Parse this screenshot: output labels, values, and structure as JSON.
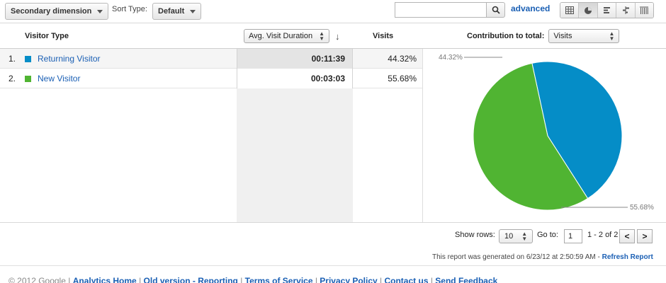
{
  "toolbar": {
    "secondary_dimension": "Secondary dimension",
    "sort_type_label": "Sort Type:",
    "sort_type_value": "Default",
    "search_placeholder": "",
    "advanced": "advanced",
    "view_icons": [
      "table-view-icon",
      "pie-view-icon",
      "performance-view-icon",
      "comparison-view-icon",
      "pivot-view-icon"
    ]
  },
  "table": {
    "headers": {
      "dimension": "Visitor Type",
      "metric_select": "Avg. Visit Duration",
      "visits": "Visits",
      "contribution_label": "Contribution to total:",
      "contribution_select": "Visits"
    },
    "rows": [
      {
        "index": "1.",
        "label": "Returning Visitor",
        "duration": "00:11:39",
        "visits": "44.32%",
        "color": "#058DC7"
      },
      {
        "index": "2.",
        "label": "New Visitor",
        "duration": "00:03:03",
        "visits": "55.68%",
        "color": "#50B432"
      }
    ]
  },
  "chart_data": {
    "type": "pie",
    "slices": [
      {
        "label": "Returning Visitor",
        "value": 44.32,
        "display": "44.32%",
        "color": "#058DC7"
      },
      {
        "label": "New Visitor",
        "value": 55.68,
        "display": "55.68%",
        "color": "#50B432"
      }
    ]
  },
  "pager": {
    "show_rows_label": "Show rows:",
    "rows_value": "10",
    "goto_label": "Go to:",
    "goto_value": "1",
    "range": "1 - 2 of 2",
    "prev": "<",
    "next": ">"
  },
  "report": {
    "generated": "This report was generated on 6/23/12 at 2:50:59 AM -",
    "refresh": "Refresh Report"
  },
  "footer": {
    "copyright": "© 2012 Google |",
    "links": [
      "Analytics Home",
      "Old version - Reporting",
      "Terms of Service",
      "Privacy Policy",
      "Contact us",
      "Send Feedback"
    ]
  }
}
